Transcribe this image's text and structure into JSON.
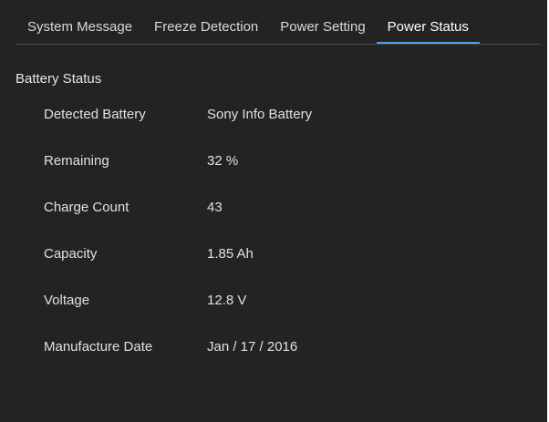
{
  "tabs": [
    {
      "label": "System Message",
      "active": false
    },
    {
      "label": "Freeze Detection",
      "active": false
    },
    {
      "label": "Power Setting",
      "active": false
    },
    {
      "label": "Power Status",
      "active": true
    }
  ],
  "section": {
    "title": "Battery Status"
  },
  "battery": {
    "rows": [
      {
        "label": "Detected Battery",
        "value": "Sony Info Battery"
      },
      {
        "label": "Remaining",
        "value": "32 %"
      },
      {
        "label": "Charge Count",
        "value": "43"
      },
      {
        "label": "Capacity",
        "value": "1.85 Ah"
      },
      {
        "label": "Voltage",
        "value": "12.8 V"
      },
      {
        "label": "Manufacture Date",
        "value": "Jan / 17 / 2016"
      }
    ]
  },
  "colors": {
    "background": "#232323",
    "accent": "#4f9fe6",
    "text": "#e6e6e6"
  }
}
